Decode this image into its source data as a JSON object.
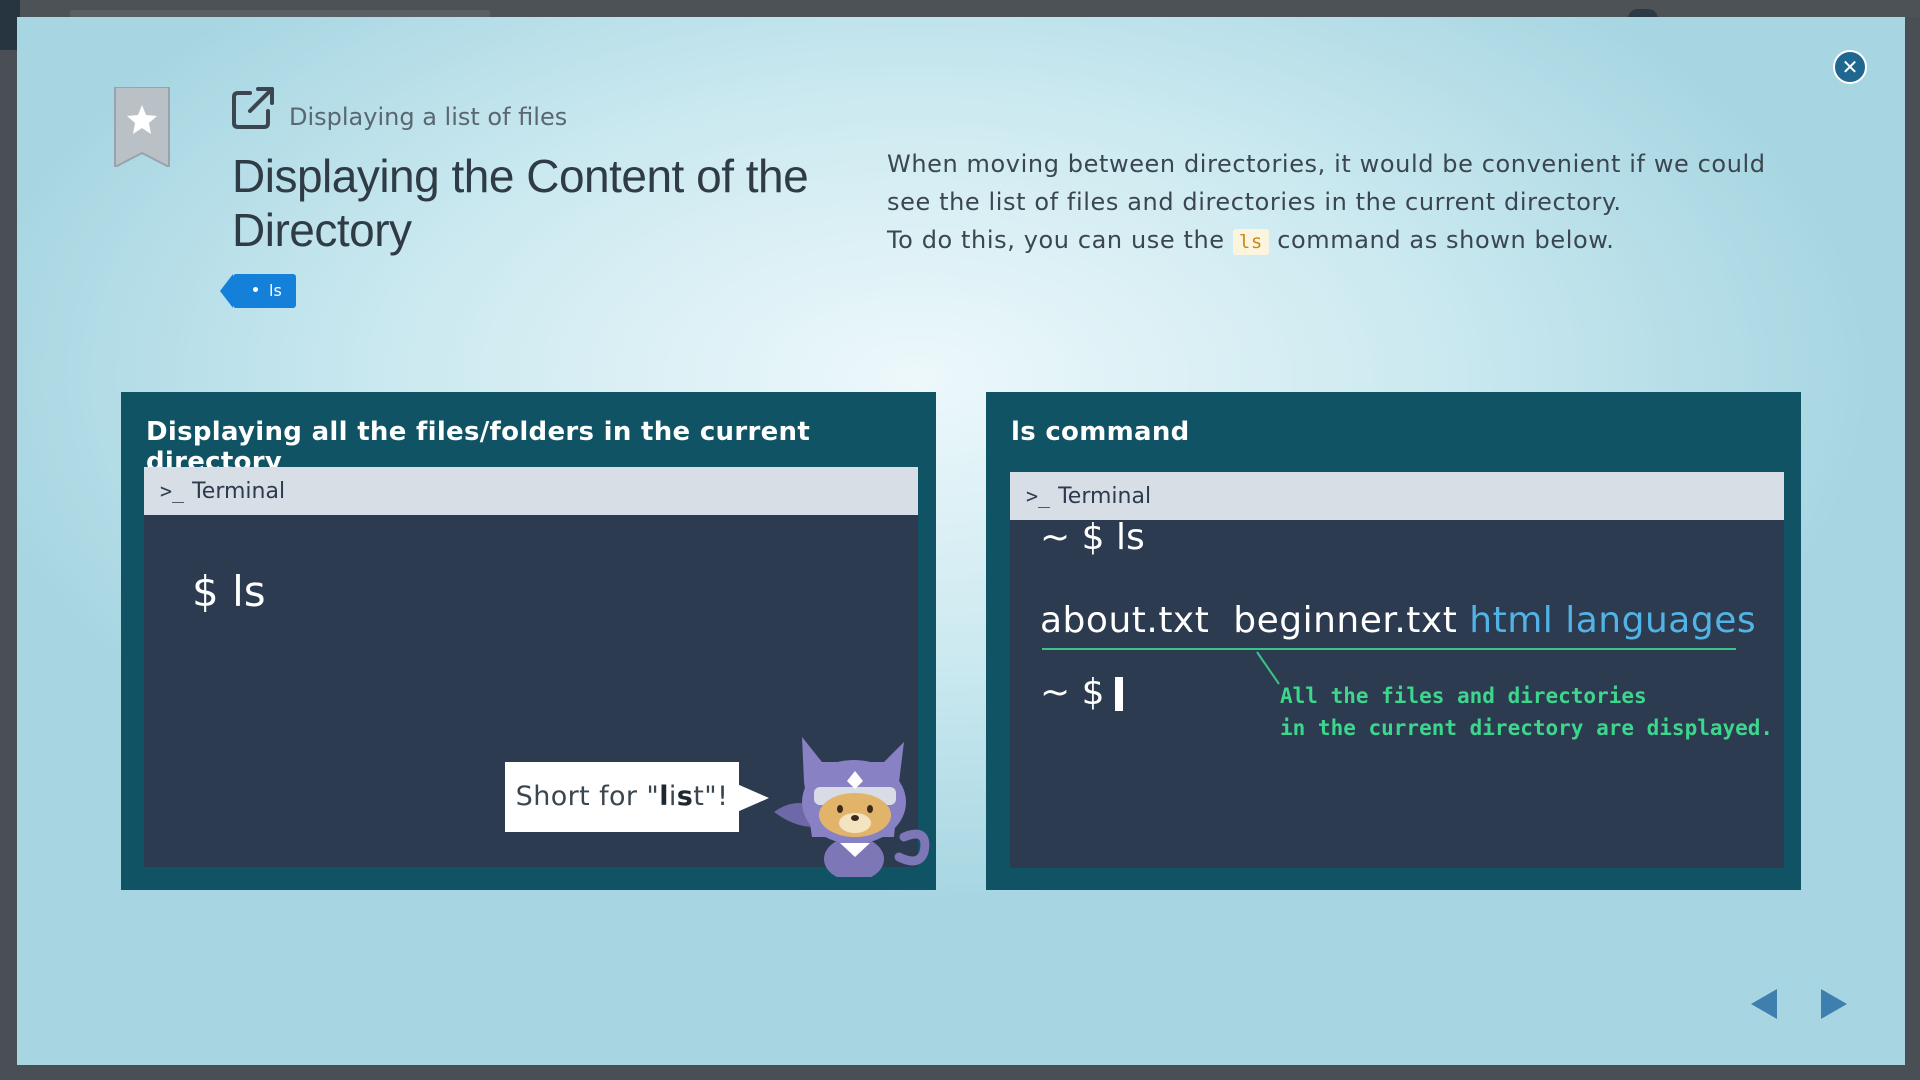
{
  "header": {
    "breadcrumb": "Displaying a list of files",
    "title": "Displaying the Content of the Directory",
    "tag": "ls"
  },
  "description": {
    "line1": "When moving between directories, it would be convenient if we could see the list of files and directories in the current directory.",
    "line2_before": "To do this, you can use the ",
    "line2_code": "ls",
    "line2_after": " command as shown below."
  },
  "left_panel": {
    "title": "Displaying all the files/folders in the current directory",
    "terminal_label": "Terminal",
    "command": "$ ls",
    "bubble_before": "Short for \"",
    "bubble_l": "l",
    "bubble_i": "i",
    "bubble_s": "s",
    "bubble_t": "t",
    "bubble_after": "\"!"
  },
  "right_panel": {
    "title": "ls command",
    "terminal_label": "Terminal",
    "line1": "~ $ ls",
    "files": "about.txt  beginner.txt",
    "dirs": "html languages",
    "line3": "~ $",
    "annotation_1": "All the files and directories",
    "annotation_2": "in the current directory are displayed."
  },
  "colors": {
    "panel": "#0f5365",
    "terminal": "#2c3b4f",
    "tag": "#1480d9",
    "dir_text": "#52b4e6",
    "annotation": "#3cd68c",
    "code": "#c98a14"
  },
  "icons": [
    "close-icon",
    "bookmark-star-icon",
    "external-link-icon",
    "terminal-prompt-icon",
    "prev-arrow-icon",
    "next-arrow-icon"
  ]
}
